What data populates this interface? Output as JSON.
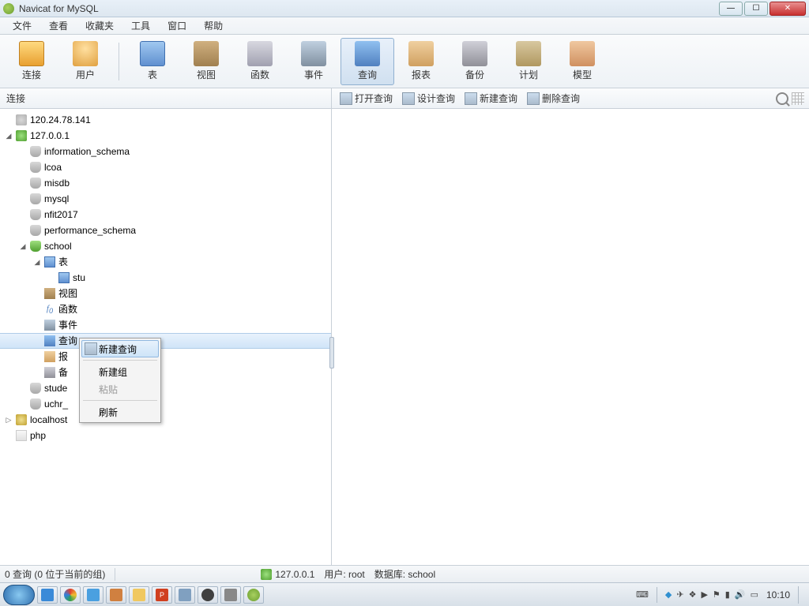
{
  "window": {
    "title": "Navicat for MySQL"
  },
  "menu": {
    "file": "文件",
    "view": "查看",
    "fav": "收藏夹",
    "tools": "工具",
    "window": "窗口",
    "help": "帮助"
  },
  "toolbar": {
    "conn": "连接",
    "user": "用户",
    "table": "表",
    "view": "视图",
    "func": "函数",
    "event": "事件",
    "query": "查询",
    "report": "报表",
    "backup": "备份",
    "schedule": "计划",
    "model": "模型"
  },
  "section": {
    "left_title": "连接",
    "actions": {
      "open": "打开查询",
      "design": "设计查询",
      "new": "新建查询",
      "delete": "删除查询"
    }
  },
  "tree": {
    "hosts": [
      {
        "name": "120.24.78.141"
      },
      {
        "name": "127.0.0.1",
        "expanded": true,
        "active": true,
        "dbs": [
          {
            "name": "information_schema"
          },
          {
            "name": "lcoa"
          },
          {
            "name": "misdb"
          },
          {
            "name": "mysql"
          },
          {
            "name": "nfit2017"
          },
          {
            "name": "performance_schema"
          },
          {
            "name": "school",
            "open": true,
            "children": {
              "tables_label": "表",
              "tables": [
                "stu"
              ],
              "views": "视图",
              "funcs": "函数",
              "events": "事件",
              "queries": "查询",
              "reports": "报表",
              "backups": "备份"
            }
          },
          {
            "name": "student"
          },
          {
            "name": "uchr_test"
          }
        ]
      },
      {
        "name": "localhost",
        "local": true
      }
    ],
    "files": [
      "php"
    ],
    "truncated": {
      "student": "stude",
      "uchr": "uchr_",
      "localhost": "localhost",
      "reports": "报",
      "backups": "备"
    }
  },
  "context_menu": {
    "new_query": "新建查询",
    "new_group": "新建组",
    "paste": "粘贴",
    "refresh": "刷新"
  },
  "status": {
    "left": "0 查询 (0 位于当前的组)",
    "host": "127.0.0.1",
    "user_label": "用户: root",
    "db_label": "数据库: school"
  },
  "taskbar": {
    "clock": "10:10"
  }
}
